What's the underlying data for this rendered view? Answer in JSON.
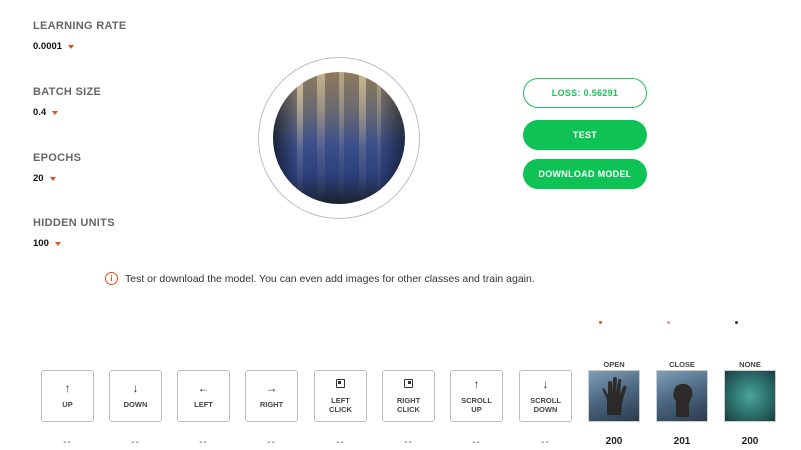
{
  "params": {
    "learning_rate": {
      "label": "LEARNING RATE",
      "value": "0.0001"
    },
    "batch_size": {
      "label": "BATCH SIZE",
      "value": "0.4"
    },
    "epochs": {
      "label": "EPOCHS",
      "value": "20"
    },
    "hidden_units": {
      "label": "HIDDEN UNITS",
      "value": "100"
    }
  },
  "actions": {
    "loss": "LOSS: 0.56291",
    "test": "TEST",
    "download": "DOWNLOAD MODEL"
  },
  "info": {
    "icon": "info-icon",
    "text": "Test or download the model. You can even add images for other classes and train again."
  },
  "controls": [
    {
      "label": "UP",
      "icon": "arrow-up-icon",
      "glyph": "↑",
      "count": "--"
    },
    {
      "label": "DOWN",
      "icon": "arrow-down-icon",
      "glyph": "↓",
      "count": "--"
    },
    {
      "label": "LEFT",
      "icon": "arrow-left-icon",
      "glyph": "←",
      "count": "--"
    },
    {
      "label": "RIGHT",
      "icon": "arrow-right-icon",
      "glyph": "→",
      "count": "--"
    },
    {
      "label": "LEFT\nCLICK",
      "icon": "left-click-icon",
      "glyph": "",
      "count": "--"
    },
    {
      "label": "RIGHT\nCLICK",
      "icon": "right-click-icon",
      "glyph": "",
      "count": "--"
    },
    {
      "label": "SCROLL\nUP",
      "icon": "scroll-up-icon",
      "glyph": "↑",
      "count": "--"
    },
    {
      "label": "SCROLL\nDOWN",
      "icon": "scroll-down-icon",
      "glyph": "↓",
      "count": "--"
    }
  ],
  "classes": [
    {
      "label": "OPEN",
      "count": "200"
    },
    {
      "label": "CLOSE",
      "count": "201"
    },
    {
      "label": "NONE",
      "count": "200"
    }
  ],
  "colors": {
    "accent": "#0fc256",
    "caret": "#e0521d",
    "dot_open": "#e0521d",
    "dot_close": "#f0909a",
    "dot_none": "#333333"
  }
}
